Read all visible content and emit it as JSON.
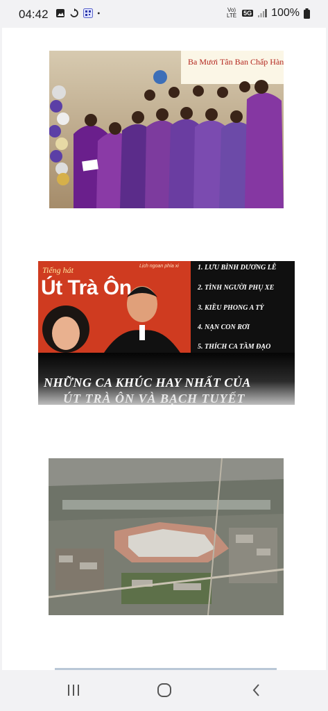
{
  "status_bar": {
    "time": "04:42",
    "left_icons": [
      "image-icon",
      "sync-icon",
      "qr-code-icon",
      "dot-icon"
    ],
    "network_label": "Vo) LTE",
    "network_type": "5G",
    "battery": "100%"
  },
  "images": [
    {
      "name": "choir-photo",
      "banner_text": "Ba Mươi Tân Ban Chấp Hành"
    },
    {
      "name": "album-cover",
      "small_label": "Lịch ngoan phía xi",
      "title_line1": "Tiếng hát",
      "title_line2": "Út Trà Ôn",
      "tracks": [
        "1. LƯU BÌNH DƯƠNG LỄ",
        "2. TÌNH NGƯỜI PHỤ XE",
        "3. KIỀU PHONG A TỶ",
        "4. NẠN CON RƠI",
        "5. THÍCH CA TẦM ĐẠO"
      ],
      "headline1": "NHỮNG CA KHÚC HAY NHẤT CỦA",
      "headline2": "ÚT TRÀ ÔN VÀ BẠCH TUYẾT"
    },
    {
      "name": "aerial-photo"
    }
  ],
  "nav_bar": {
    "buttons": [
      "recent-apps",
      "home",
      "back"
    ]
  }
}
